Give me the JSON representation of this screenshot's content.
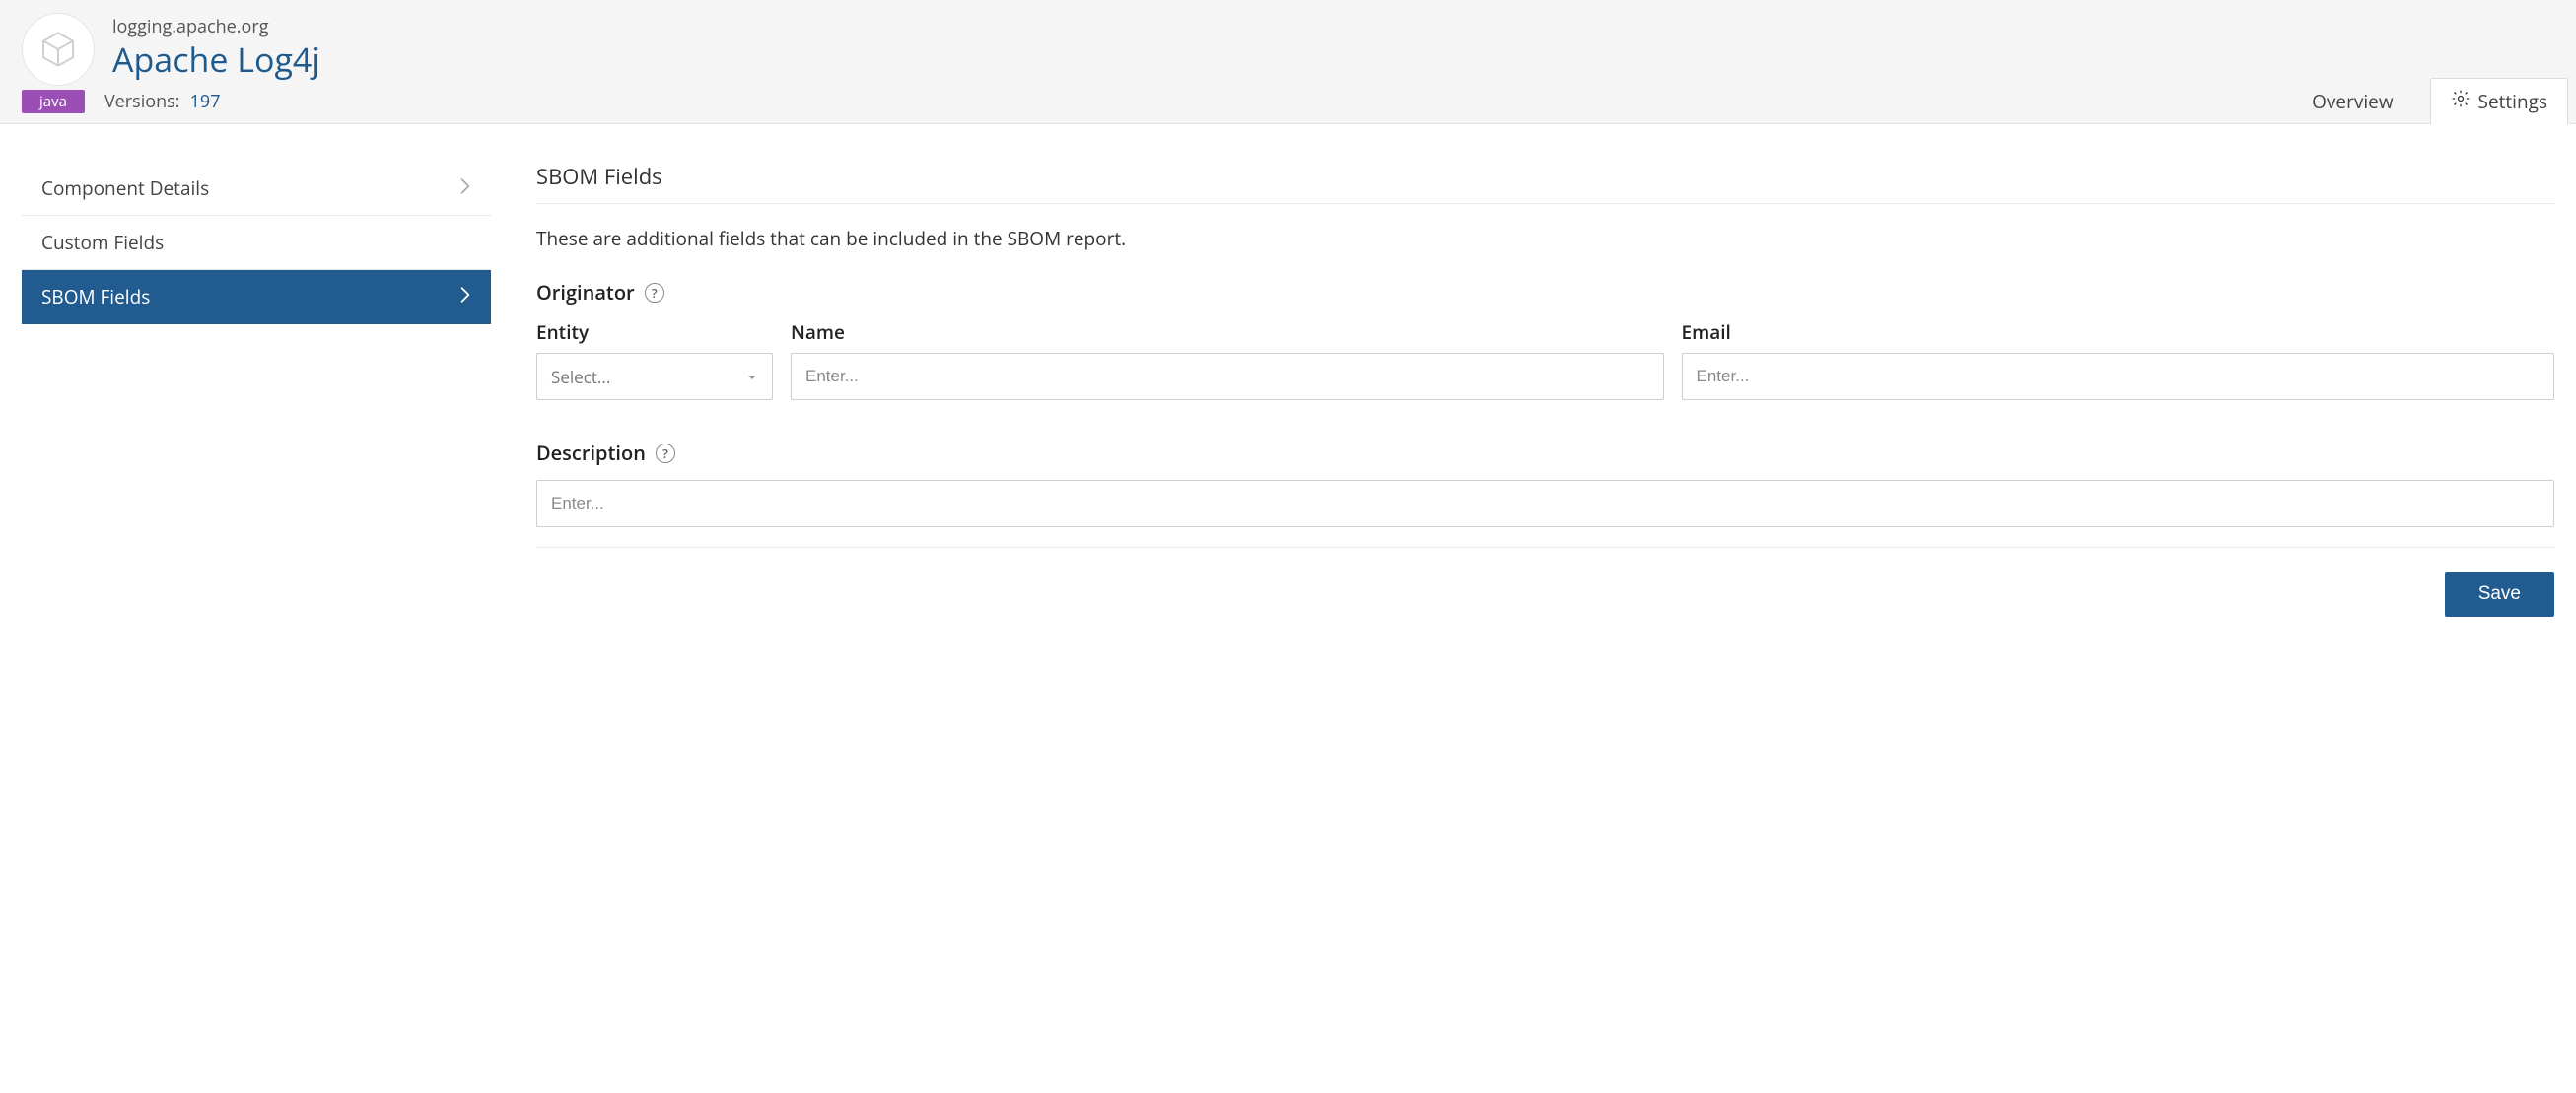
{
  "header": {
    "pretitle": "logging.apache.org",
    "title": "Apache Log4j",
    "lang_badge": "java",
    "versions_label": "Versions:",
    "versions_count": "197",
    "tabs": {
      "overview": "Overview",
      "settings": "Settings"
    }
  },
  "sidebar": {
    "items": [
      {
        "label": "Component Details"
      },
      {
        "label": "Custom Fields"
      },
      {
        "label": "SBOM Fields"
      }
    ]
  },
  "form": {
    "section_title": "SBOM Fields",
    "section_desc": "These are additional fields that can be included in the SBOM report.",
    "originator": {
      "label": "Originator",
      "entity_label": "Entity",
      "entity_placeholder": "Select...",
      "name_label": "Name",
      "name_placeholder": "Enter...",
      "email_label": "Email",
      "email_placeholder": "Enter..."
    },
    "description": {
      "label": "Description",
      "placeholder": "Enter..."
    },
    "save": "Save"
  }
}
